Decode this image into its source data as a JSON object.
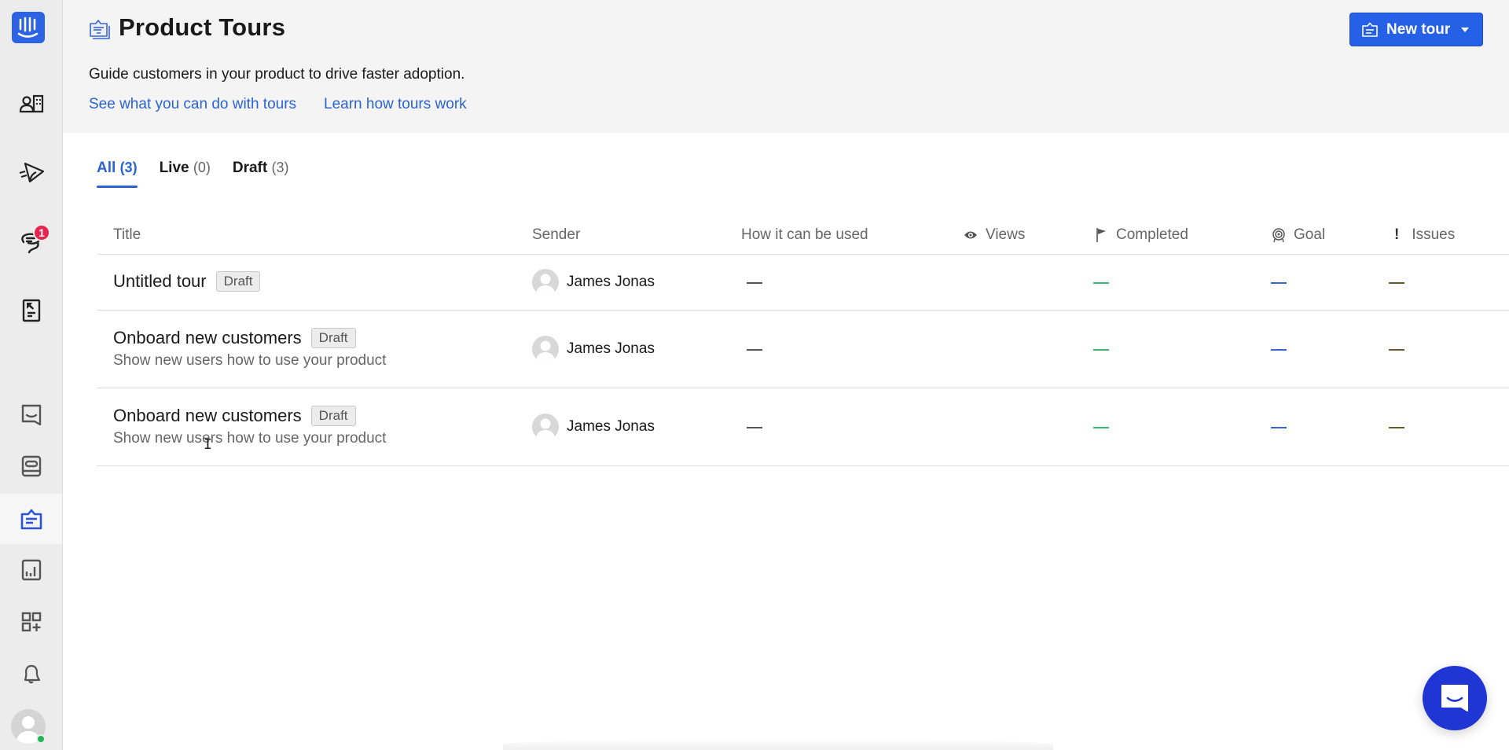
{
  "sidebar": {
    "logo": "intercom-logo-icon",
    "items": [
      {
        "name": "contacts",
        "icon": "contacts-icon",
        "active": false
      },
      {
        "name": "outbound",
        "icon": "paper-plane-icon",
        "active": false
      },
      {
        "name": "inbox",
        "icon": "chat-bubbles-icon",
        "active": false,
        "badge": "1"
      },
      {
        "name": "articles",
        "icon": "article-icon",
        "active": false
      },
      {
        "name": "messenger",
        "icon": "messenger-icon",
        "active": false
      },
      {
        "name": "operator",
        "icon": "bot-card-icon",
        "active": false
      },
      {
        "name": "product-tours",
        "icon": "product-tours-icon",
        "active": true
      },
      {
        "name": "reports",
        "icon": "bar-chart-icon",
        "active": false
      },
      {
        "name": "app-store",
        "icon": "apps-grid-plus-icon",
        "active": false
      },
      {
        "name": "notifications",
        "icon": "bell-icon",
        "active": false
      }
    ],
    "user_status": "online"
  },
  "header": {
    "title": "Product Tours",
    "subtitle": "Guide customers in your product to drive faster adoption.",
    "links": [
      {
        "label": "See what you can do with tours"
      },
      {
        "label": "Learn how tours work"
      }
    ],
    "new_button": "New tour"
  },
  "tabs": [
    {
      "label": "All",
      "count": "(3)",
      "active": true
    },
    {
      "label": "Live",
      "count": "(0)",
      "active": false
    },
    {
      "label": "Draft",
      "count": "(3)",
      "active": false
    }
  ],
  "table": {
    "columns": [
      "Title",
      "Sender",
      "How it can be used",
      "Views",
      "Completed",
      "Goal",
      "Issues"
    ],
    "rows": [
      {
        "title": "Untitled tour",
        "status": "Draft",
        "description": "",
        "sender": "James Jonas",
        "usage": "—",
        "views": "",
        "completed": "—",
        "goal": "—",
        "issues": "—"
      },
      {
        "title": "Onboard new customers",
        "status": "Draft",
        "description": "Show new users how to use your product",
        "sender": "James Jonas",
        "usage": "—",
        "views": "",
        "completed": "—",
        "goal": "—",
        "issues": "—"
      },
      {
        "title": "Onboard new customers",
        "status": "Draft",
        "description": "Show new users how to use your product",
        "sender": "James Jonas",
        "usage": "—",
        "views": "",
        "completed": "—",
        "goal": "—",
        "issues": "—"
      }
    ]
  },
  "colors": {
    "accent": "#2560e6",
    "link": "#2a63d4",
    "badge": "#e5244f",
    "completed": "#3db36e",
    "goal": "#3a66cf",
    "issues": "#6b5a2a",
    "launcher": "#1f35d4"
  }
}
